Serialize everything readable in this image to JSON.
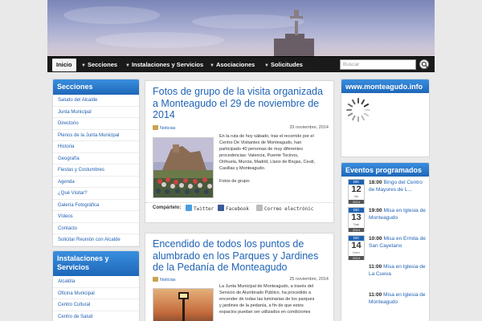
{
  "nav": {
    "items": [
      {
        "label": "Inicio",
        "active": true
      },
      {
        "label": "Secciones"
      },
      {
        "label": "Instalaciones y Servicios"
      },
      {
        "label": "Asociaciones"
      },
      {
        "label": "Solicitudes"
      }
    ],
    "search_placeholder": "Buscar"
  },
  "sidebar": {
    "sections_title": "Secciones",
    "sections": [
      "Saludo del Alcalde",
      "Junta Municipal",
      "Directorio",
      "Plenos de la Junta Municipal",
      "Historia",
      "Geografía",
      "Fiestas y Costumbres",
      "Agenda",
      "¿Qué Visitar?",
      "Galería Fotográfica",
      "Vídeos",
      "Contacto",
      "Solicitar Reunión con Alcalde"
    ],
    "services_title": "Instalaciones y Servicios",
    "services": [
      "Alcaldía",
      "Oficina Municipal",
      "Centro Cultural",
      "Centro de Salud"
    ]
  },
  "posts": [
    {
      "title": "Fotos de grupo de la visita organizada a Monteagudo el 29 de noviembre de 2014",
      "category": "Noticias",
      "date": "29 noviembre, 2014",
      "text": [
        "En la ruta de hoy sábado, tras el recorrido por el",
        "Centro De Visitantes de Monteagudo, han",
        "participado 40 personas de muy diferentes",
        "procedencias: Valencia, Puente Tocinos,",
        "Orihuela, Murcia, Madrid, Llano de Brujas, Ceutí,",
        "Casillas y Monteagudo.",
        "",
        "Fotos de grupo:"
      ],
      "share_label": "Compártelo:",
      "share_buttons": [
        "Twitter",
        "Facebook",
        "Correo electrónic"
      ]
    },
    {
      "title": "Encendido de todos los puntos de alumbrado en los Parques y Jardines de la Pedanía de Monteagudo",
      "category": "Noticias",
      "date": "25 noviembre, 2014",
      "text": [
        "La Junta Municipal de Monteagudo, a través del",
        "Servicio de Alumbrado Público, ha procedido a",
        "encender de todas las luminarias de los parques",
        "y jardines de la pedanía, a fin de que estos",
        "espacios puedan ser utilizados en condiciones"
      ]
    }
  ],
  "right": {
    "site_title": "www.monteagudo.info",
    "events_title": "Eventos programados",
    "events": [
      {
        "month": "DIC",
        "day": "12",
        "weekday": "Vie",
        "year": "2014",
        "time": "18:00",
        "title": "Bingo del Centro de Mayores de L..."
      },
      {
        "month": "DIC",
        "day": "13",
        "weekday": "Sab",
        "year": "2014",
        "time": "19:00",
        "title": "Misa en Iglesia de Monteagudo"
      },
      {
        "month": "DIC",
        "day": "14",
        "weekday": "Dom",
        "year": "2014",
        "time": "10:00",
        "title": "Misa en Ermita de San Cayetano"
      },
      {
        "month": "",
        "day": "",
        "weekday": "",
        "year": "",
        "time": "11:00",
        "title": "Misa en Iglesia de La Cueva"
      },
      {
        "month": "",
        "day": "",
        "weekday": "",
        "year": "",
        "time": "11:00",
        "title": "Misa en Iglesia de Monteagudo"
      }
    ]
  },
  "colors": {
    "accent": "#1f63b5",
    "nav_bg": "#1a1a1a",
    "page_bg": "#e9e9e9"
  }
}
